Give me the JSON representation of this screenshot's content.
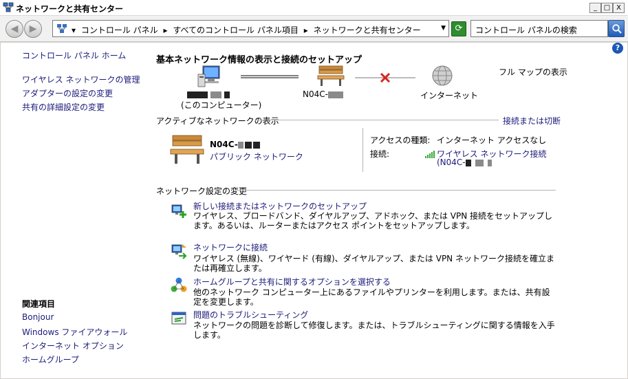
{
  "window": {
    "title": "ネットワークと共有センター",
    "min": "_",
    "max": "□",
    "close": "X"
  },
  "addressbar": {
    "crumbs": [
      "▾",
      "コントロール パネル",
      "▸",
      "すべてのコントロール パネル項目",
      "▸",
      "ネットワークと共有センター"
    ],
    "search_placeholder": "コントロール パネルの検索"
  },
  "sidebar": {
    "home": "コントロール パネル ホーム",
    "links": [
      "ワイヤレス ネットワークの管理",
      "アダプターの設定の変更",
      "共有の詳細設定の変更"
    ],
    "related_title": "関連項目",
    "related": [
      "Bonjour",
      "Windows ファイアウォール",
      "インターネット オプション",
      "ホームグループ"
    ]
  },
  "main": {
    "title": "基本ネットワーク情報の表示と接続のセットアップ",
    "full_map": "フル マップの表示",
    "map": {
      "computer_label": "(このコンピューター)",
      "network_label": "N04C-",
      "internet_label": "インターネット"
    },
    "active_head": "アクティブなネットワークの表示",
    "connect_toggle": "接続または切断",
    "network": {
      "name": "N04C-",
      "type": "パブリック ネットワーク",
      "access_key": "アクセスの種類:",
      "access_value": "インターネット アクセスなし",
      "conn_key": "接続:",
      "conn_value": "ワイヤレス ネットワーク接続",
      "conn_sub": "(N04C-"
    },
    "settings_head": "ネットワーク設定の変更",
    "tasks": [
      {
        "title": "新しい接続またはネットワークのセットアップ",
        "desc": "ワイヤレス、ブロードバンド、ダイヤルアップ、アドホック、または VPN 接続をセットアップします。あるいは、ルーターまたはアクセス ポイントをセットアップします。",
        "icon": "new-connection-icon"
      },
      {
        "title": "ネットワークに接続",
        "desc": "ワイヤレス (無線)、ワイヤード (有線)、ダイヤルアップ、または VPN ネットワーク接続を確立または再確立します。",
        "icon": "connect-network-icon"
      },
      {
        "title": "ホームグループと共有に関するオプションを選択する",
        "desc": "他のネットワーク コンピューター上にあるファイルやプリンターを利用します。または、共有設定を変更します。",
        "icon": "homegroup-icon"
      },
      {
        "title": "問題のトラブルシューティング",
        "desc": "ネットワークの問題を診断して修復します。または、トラブルシューティングに関する情報を入手します。",
        "icon": "troubleshoot-icon"
      }
    ]
  }
}
